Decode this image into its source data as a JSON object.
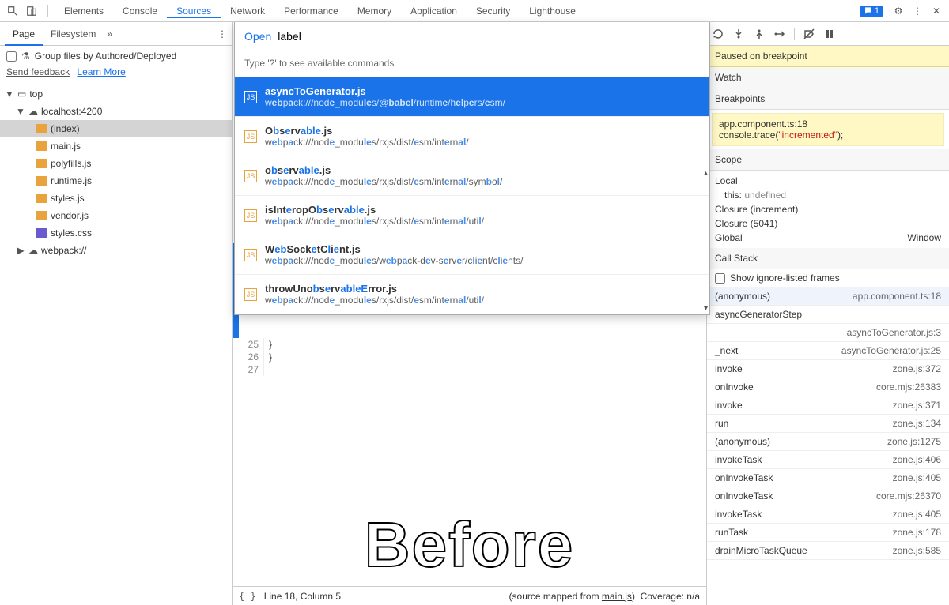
{
  "topTabs": [
    "Elements",
    "Console",
    "Sources",
    "Network",
    "Performance",
    "Memory",
    "Application",
    "Security",
    "Lighthouse"
  ],
  "activeTopTab": "Sources",
  "errBadge": "1",
  "sideTabs": {
    "page": "Page",
    "fs": "Filesystem"
  },
  "group": {
    "label": "Group files by Authored/Deployed",
    "feedback": "Send feedback",
    "learn": "Learn More"
  },
  "tree": {
    "top": "top",
    "host": "localhost:4200",
    "files": [
      "(index)",
      "main.js",
      "polyfills.js",
      "runtime.js",
      "styles.js",
      "vendor.js",
      "styles.css"
    ],
    "webpack": "webpack://"
  },
  "palette": {
    "open": "Open",
    "query": "label",
    "hint": "Type '?' to see available commands",
    "items": [
      {
        "t": "asyncToGenerator.js",
        "p": "webpack:///node_modules/@babel/runtime/helpers/esm/"
      },
      {
        "t": "Observable.js",
        "p": "webpack:///node_modules/rxjs/dist/esm/internal/"
      },
      {
        "t": "observable.js",
        "p": "webpack:///node_modules/rxjs/dist/esm/internal/symbol/"
      },
      {
        "t": "isInteropObservable.js",
        "p": "webpack:///node_modules/rxjs/dist/esm/internal/util/"
      },
      {
        "t": "WebSocketClient.js",
        "p": "webpack:///node_modules/webpack-dev-server/client/clients/"
      },
      {
        "t": "throwUnobservableError.js",
        "p": "webpack:///node_modules/rxjs/dist/esm/internal/util/"
      }
    ]
  },
  "gutterStart": 25,
  "gutterCount": 3,
  "codeLines": [
    "  }",
    "}",
    ""
  ],
  "beforeText": "Before",
  "status": {
    "pos": "Line 18, Column 5",
    "mapped": "(source mapped from ",
    "mappedFile": "main.js",
    "mappedEnd": ")",
    "coverage": "Coverage: n/a"
  },
  "dbg": {
    "paused": "Paused on breakpoint",
    "watch": "Watch",
    "breakpoints": "Breakpoints",
    "bpFile": "app.component.ts:18",
    "bpCode": "console.trace(\"incremented\");",
    "scope": "Scope",
    "local": "Local",
    "thisLbl": "this:",
    "thisVal": "undefined",
    "closure1": "Closure (increment)",
    "closure2": "Closure (5041)",
    "global": "Global",
    "globalVal": "Window",
    "callstack": "Call Stack",
    "showIgnore": "Show ignore-listed frames",
    "frames": [
      {
        "n": "(anonymous)",
        "l": "app.component.ts:18",
        "sel": true
      },
      {
        "n": "asyncGeneratorStep",
        "l": ""
      },
      {
        "n": "",
        "l": "asyncToGenerator.js:3"
      },
      {
        "n": "_next",
        "l": "asyncToGenerator.js:25"
      },
      {
        "n": "invoke",
        "l": "zone.js:372"
      },
      {
        "n": "onInvoke",
        "l": "core.mjs:26383"
      },
      {
        "n": "invoke",
        "l": "zone.js:371"
      },
      {
        "n": "run",
        "l": "zone.js:134"
      },
      {
        "n": "(anonymous)",
        "l": "zone.js:1275"
      },
      {
        "n": "invokeTask",
        "l": "zone.js:406"
      },
      {
        "n": "onInvokeTask",
        "l": "zone.js:405"
      },
      {
        "n": "onInvokeTask",
        "l": "core.mjs:26370"
      },
      {
        "n": "invokeTask",
        "l": "zone.js:405"
      },
      {
        "n": "runTask",
        "l": "zone.js:178"
      },
      {
        "n": "drainMicroTaskQueue",
        "l": "zone.js:585"
      }
    ]
  }
}
